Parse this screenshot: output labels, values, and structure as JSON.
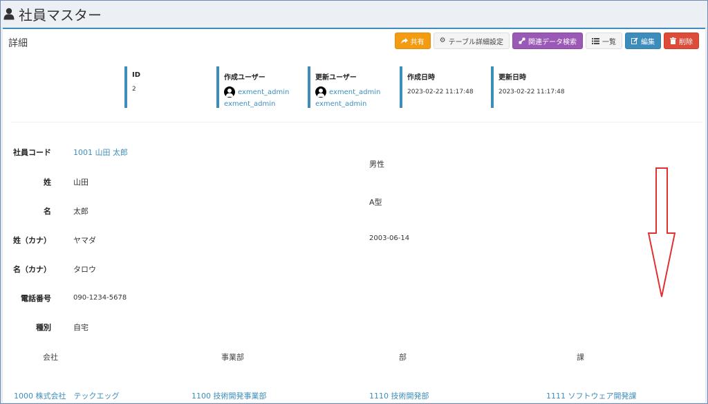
{
  "header": {
    "title": "社員マスター",
    "icon": "user-icon"
  },
  "box": {
    "title": "詳細"
  },
  "toolbar": {
    "share": "共有",
    "table_setting": "テーブル詳細設定",
    "related_search": "関連データ検索",
    "list": "一覧",
    "edit": "編集",
    "delete": "削除"
  },
  "sysinfo": {
    "id_label": "ID",
    "id_value": "2",
    "created_user_label": "作成ユーザー",
    "created_user": "exment_admin",
    "created_user_sub": "exment_admin",
    "updated_user_label": "更新ユーザー",
    "updated_user": "exment_admin",
    "updated_user_sub": "exment_admin",
    "created_at_label": "作成日時",
    "created_at": "2023-02-22 11:17:48",
    "updated_at_label": "更新日時",
    "updated_at": "2023-02-22 11:17:48"
  },
  "fields": [
    {
      "label": "社員コード",
      "value": "1001 山田 太郎"
    },
    {
      "label": "姓",
      "value": "山田"
    },
    {
      "label": "名",
      "value": "太郎"
    },
    {
      "label": "姓（カナ）",
      "value": "ヤマダ"
    },
    {
      "label": "名（カナ）",
      "value": "タロウ"
    },
    {
      "label": "電話番号",
      "value": "090-1234-5678"
    },
    {
      "label": "種別",
      "value": "自宅"
    }
  ],
  "right_fields": {
    "gender": "男性",
    "blood": "A型",
    "birthday": "2003-06-14"
  },
  "org": {
    "headers": [
      "会社",
      "事業部",
      "部",
      "課"
    ],
    "values": [
      "1000 株式会社　テックエッグ",
      "1100 技術開発事業部",
      "1110 技術開発部",
      "1111 ソフトウェア開発課"
    ]
  },
  "colors": {
    "primary": "#3c8dbc",
    "warning": "#f39c12",
    "purple": "#9b59b6",
    "danger": "#dd4b39",
    "annotation": "#e03030"
  }
}
